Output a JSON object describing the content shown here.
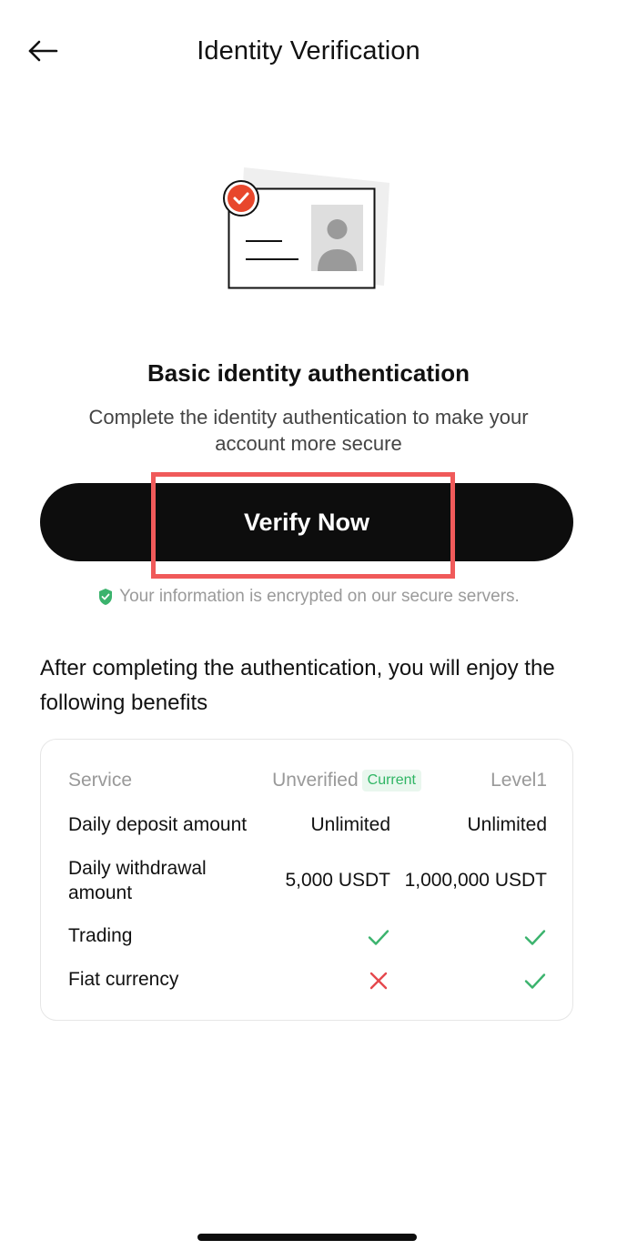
{
  "header": {
    "title": "Identity Verification",
    "back_icon": "arrow-left-icon"
  },
  "hero": {
    "title": "Basic identity authentication",
    "subtitle": "Complete the identity authentication to make your account more secure",
    "illustration_icon": "id-card-verified-icon"
  },
  "verify_button": {
    "label": "Verify Now"
  },
  "secure_note": {
    "text": "Your information is encrypted on our secure servers.",
    "icon": "shield-check-icon"
  },
  "benefits": {
    "title": "After completing the authentication, you will enjoy the following benefits",
    "header": {
      "service": "Service",
      "col1": "Unverified",
      "col1_badge": "Current",
      "col2": "Level1"
    },
    "rows": [
      {
        "service": "Daily deposit amount",
        "col1": "Unlimited",
        "col2": "Unlimited"
      },
      {
        "service": "Daily withdrawal amount",
        "col1": "5,000 USDT",
        "col2": "1,000,000 USDT"
      },
      {
        "service": "Trading",
        "col1_icon": "check-icon",
        "col2_icon": "check-icon"
      },
      {
        "service": "Fiat currency",
        "col1_icon": "cross-icon",
        "col2_icon": "check-icon"
      }
    ]
  },
  "colors": {
    "accent_red": "#e8472c",
    "check_green": "#3bb36d",
    "cross_red": "#e5484d",
    "button_bg": "#0d0d0d",
    "highlight_red": "#f05a5a"
  }
}
